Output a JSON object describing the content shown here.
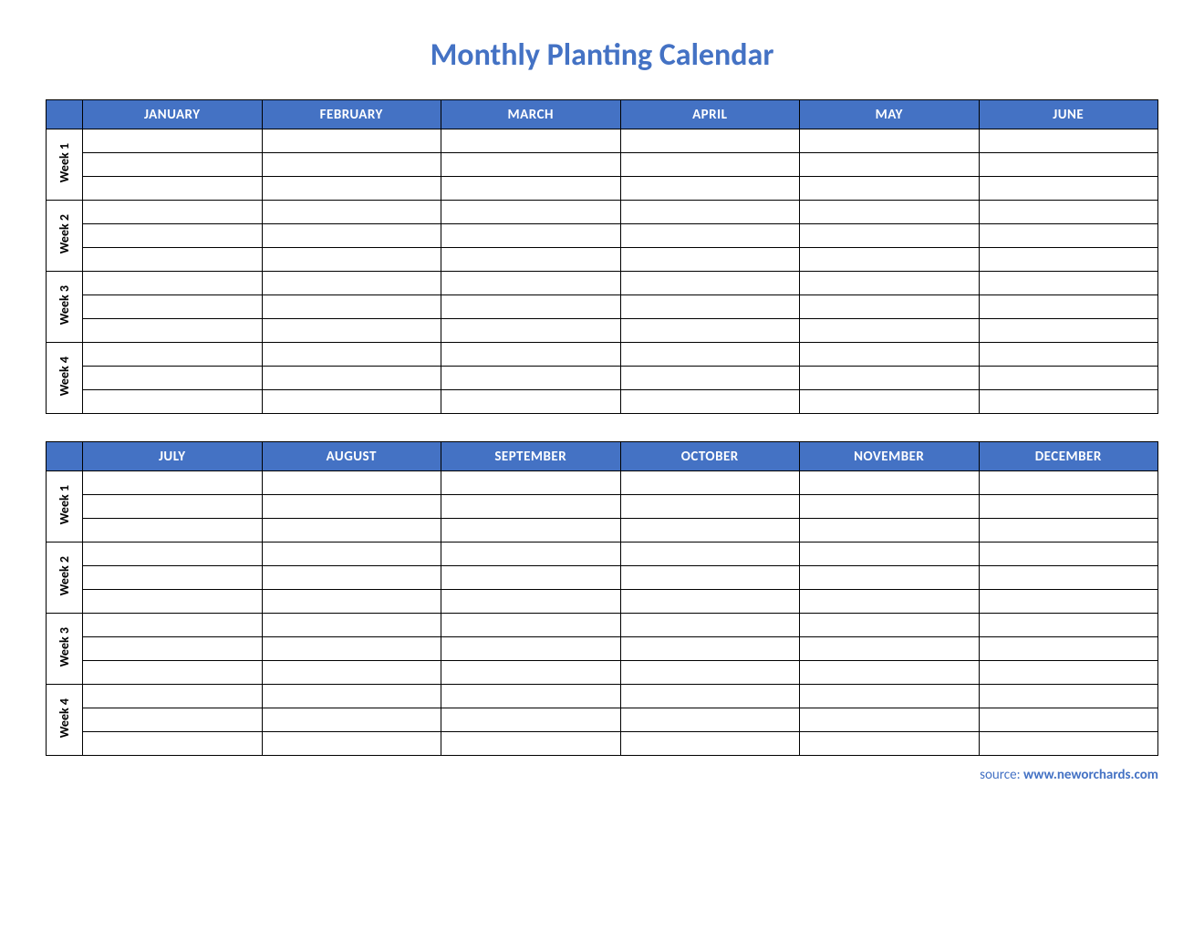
{
  "title": "Monthly Planting Calendar",
  "tables": [
    {
      "months": [
        "JANUARY",
        "FEBRUARY",
        "MARCH",
        "APRIL",
        "MAY",
        "JUNE"
      ],
      "weeks": [
        "Week 1",
        "Week 2",
        "Week 3",
        "Week 4"
      ]
    },
    {
      "months": [
        "JULY",
        "AUGUST",
        "SEPTEMBER",
        "OCTOBER",
        "NOVEMBER",
        "DECEMBER"
      ],
      "weeks": [
        "Week 1",
        "Week 2",
        "Week 3",
        "Week 4"
      ]
    }
  ],
  "source_prefix": "source: ",
  "source_site": "www.neworchards.com"
}
